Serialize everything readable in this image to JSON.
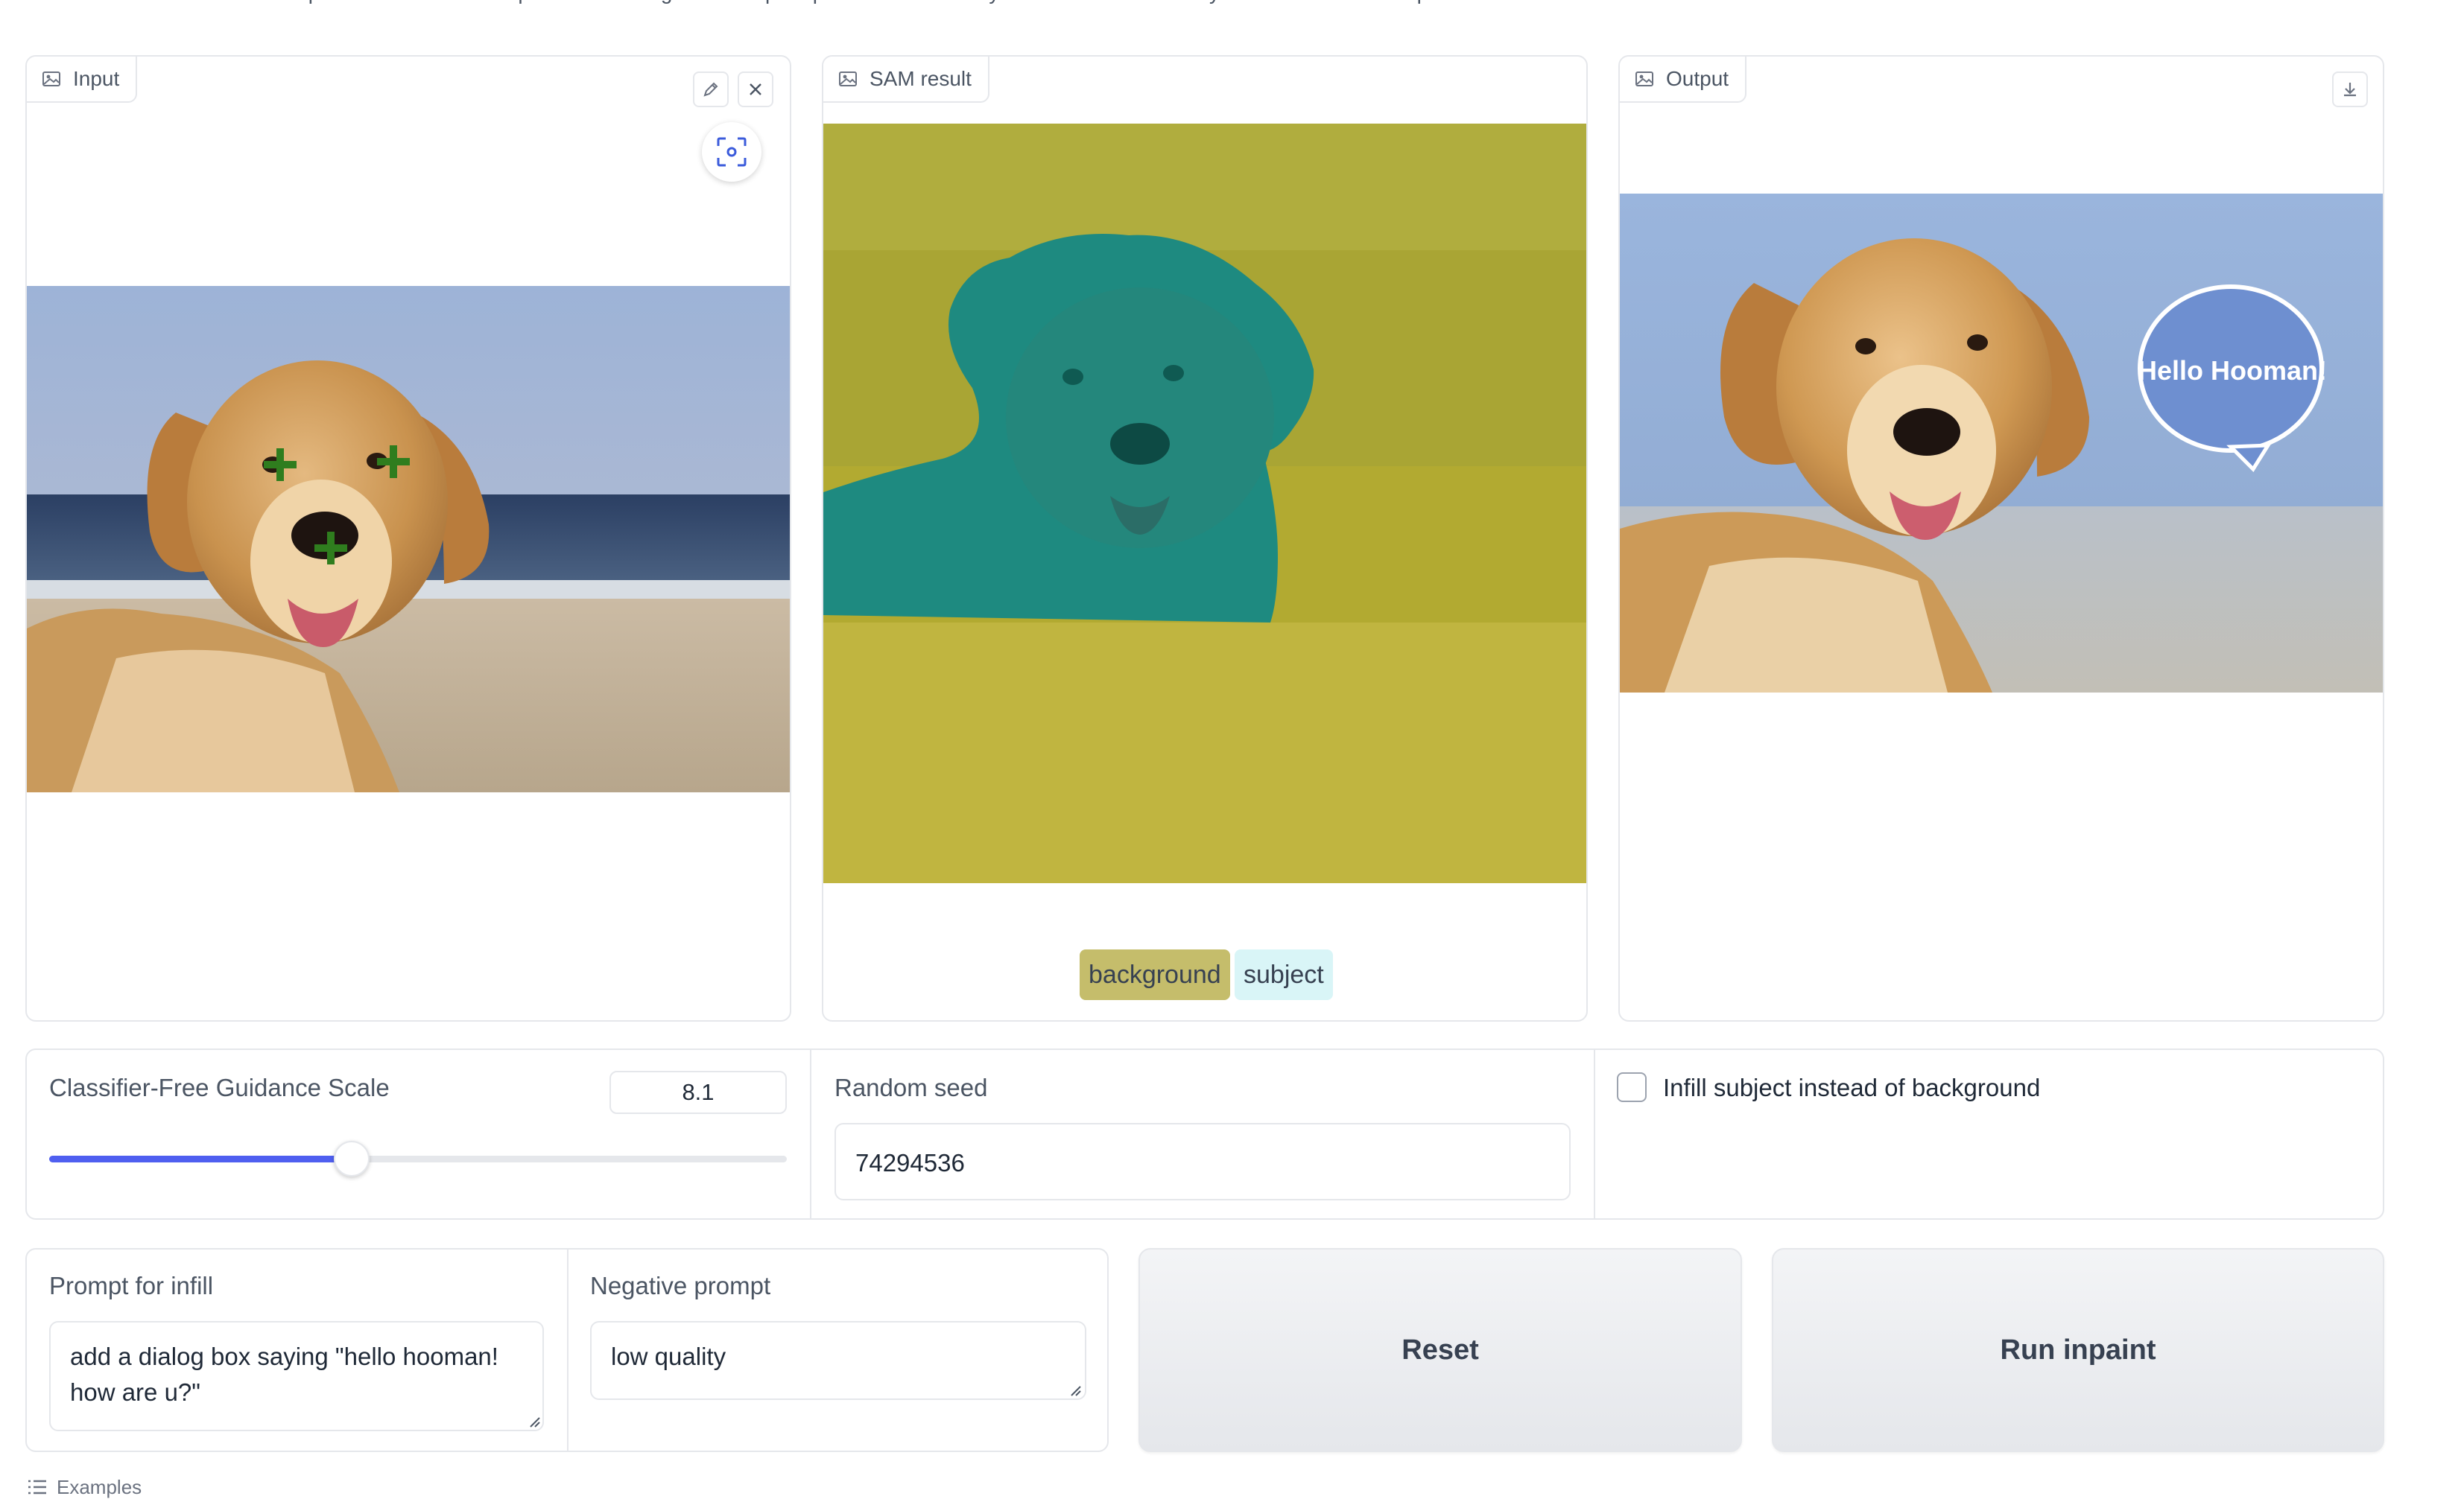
{
  "intro_text": "Scroll down to see a few examples. Click on an example and the image and the prompts will be filled for you. Note however that you still need to do step 2 and 4.",
  "panels": {
    "input": {
      "label": "Input"
    },
    "sam": {
      "label": "SAM result"
    },
    "output": {
      "label": "Output",
      "bubble_text": "Hello Hooman!"
    }
  },
  "legend": [
    {
      "label": "background",
      "color": "#c5bd6b"
    },
    {
      "label": "subject",
      "color": "#d9f5f7"
    }
  ],
  "controls": {
    "cfg": {
      "label": "Classifier-Free Guidance Scale",
      "value": "8.1",
      "fraction": 0.41
    },
    "seed": {
      "label": "Random seed",
      "value": "74294536"
    },
    "infill": {
      "label": "Infill subject instead of background",
      "checked": false
    }
  },
  "prompts": {
    "prompt": {
      "label": "Prompt for infill",
      "value": "add a dialog box saying \"hello hooman! how are u?\""
    },
    "negative": {
      "label": "Negative prompt",
      "value": "low quality"
    }
  },
  "buttons": {
    "reset": "Reset",
    "run": "Run inpaint"
  },
  "examples_label": "Examples",
  "colors": {
    "accent": "#4f5ff0",
    "mask_background": "#b0ad3e",
    "mask_subject": "#1e8a80"
  },
  "icons": {
    "image": "image-icon",
    "edit": "pencil-icon",
    "clear": "close-icon",
    "focus": "focus-icon",
    "download": "download-icon",
    "examples": "list-icon"
  }
}
